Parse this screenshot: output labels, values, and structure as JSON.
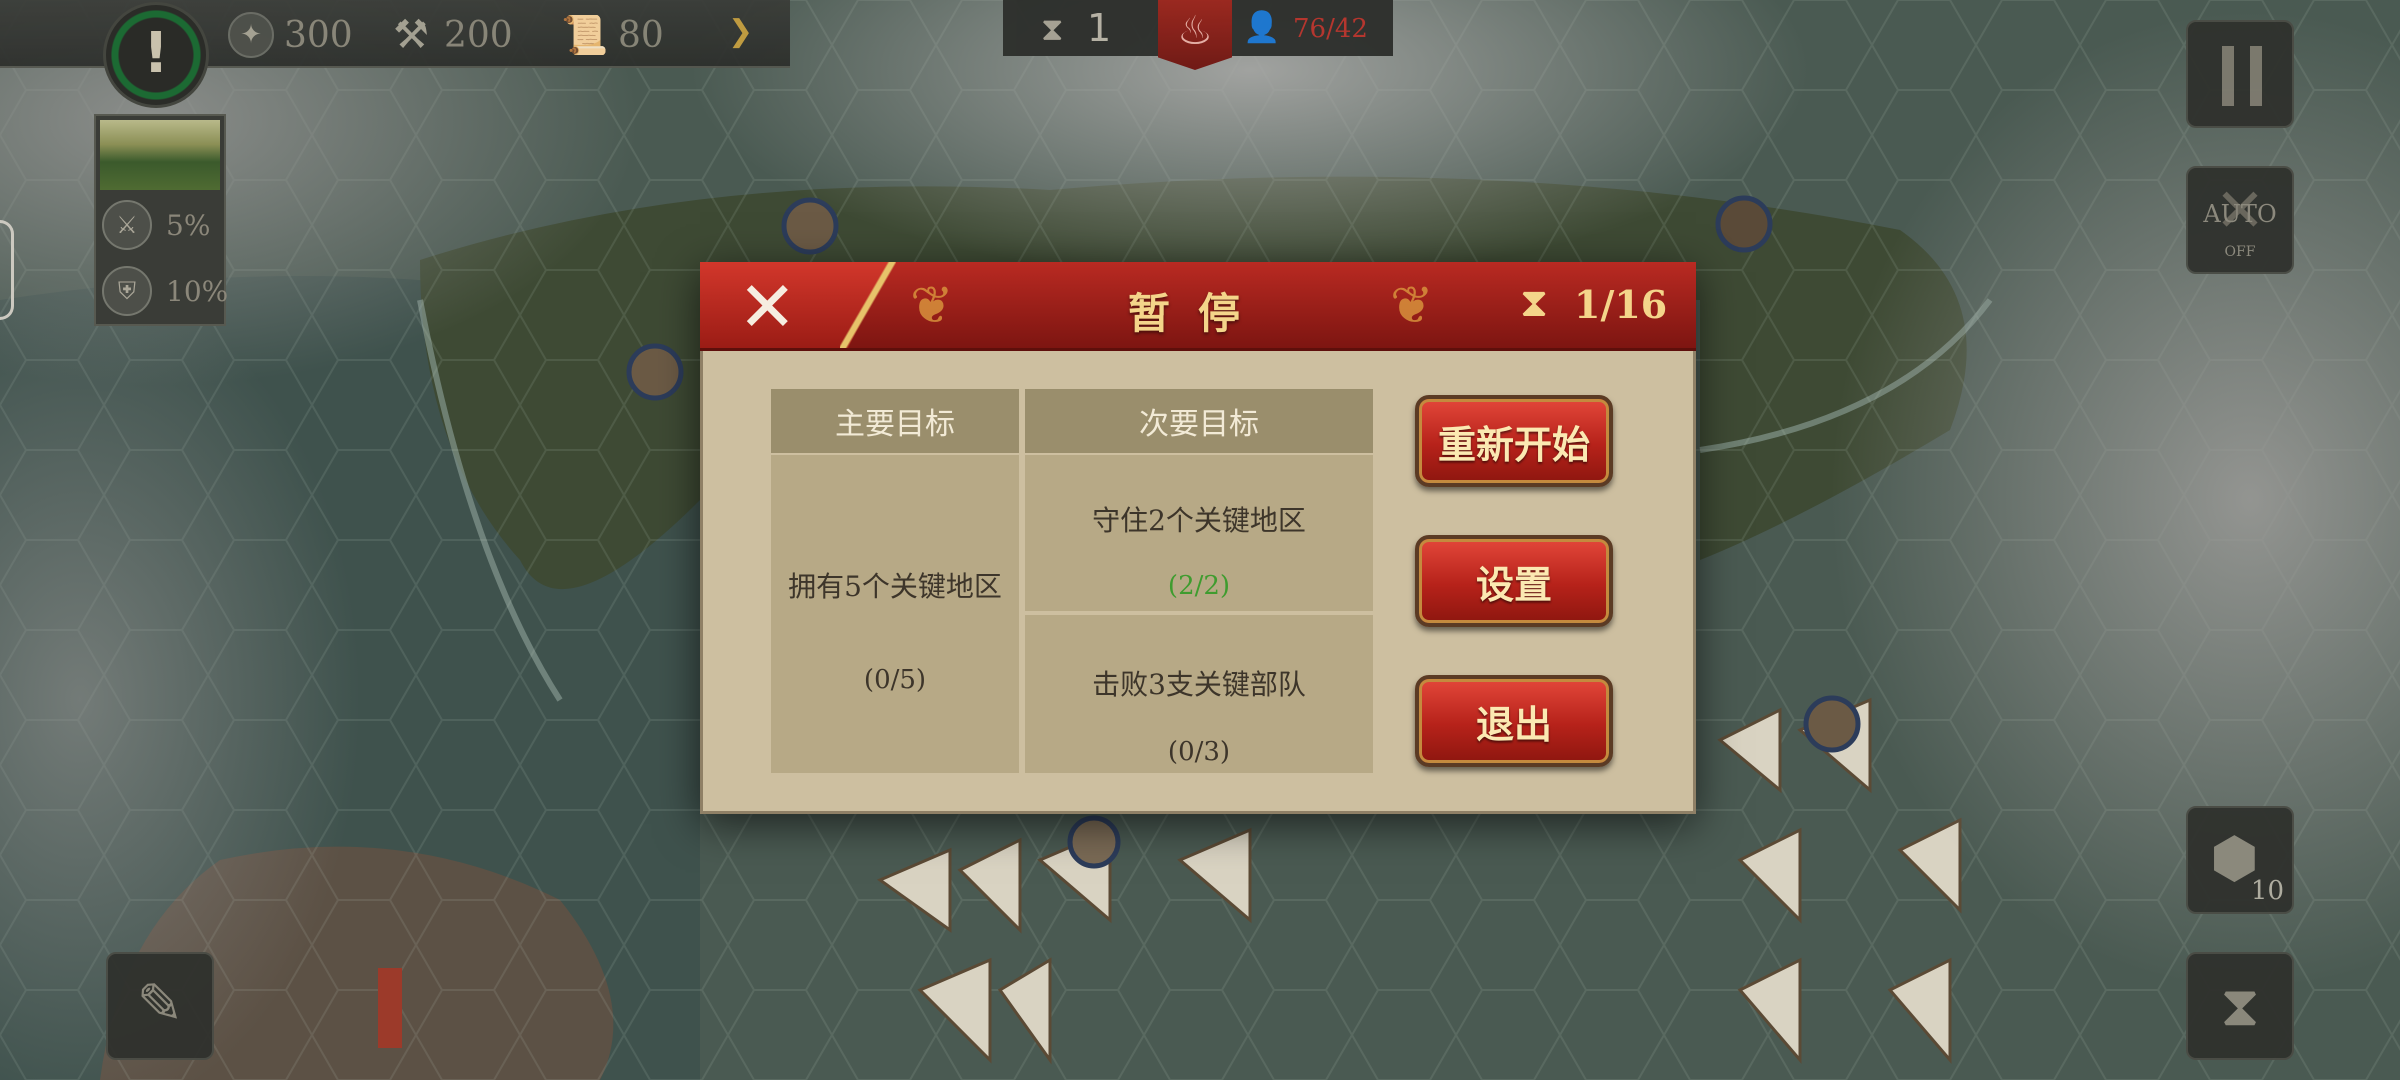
{
  "hud": {
    "alert_icon": "exclamation-icon",
    "resources": [
      {
        "name": "gold-icon",
        "value": "300"
      },
      {
        "name": "hammer-icon",
        "value": "200"
      },
      {
        "name": "scroll-icon",
        "value": "80"
      }
    ],
    "turn": "1",
    "population": "76/42",
    "colors": {
      "accent_red": "#b92a22",
      "gold_text": "#f4d58a",
      "progress_green": "#3f9c2f"
    }
  },
  "terrain": {
    "attack_bonus": "5%",
    "defense_bonus": "10%"
  },
  "right_panel": {
    "auto_label": "AUTO",
    "auto_state": "OFF",
    "unit_count": "10"
  },
  "dialog": {
    "title": "暂停",
    "turn_progress": "1/16",
    "primary_header": "主要目标",
    "secondary_header": "次要目标",
    "primary": {
      "text": "拥有5个关键地区",
      "progress": "(0/5)"
    },
    "secondary": [
      {
        "text": "守住2个关键地区",
        "progress": "(2/2)",
        "complete": true
      },
      {
        "text": "击败3支关键部队",
        "progress": "(0/3)",
        "complete": false
      }
    ],
    "buttons": {
      "restart": "重新开始",
      "settings": "设置",
      "exit": "退出"
    }
  }
}
